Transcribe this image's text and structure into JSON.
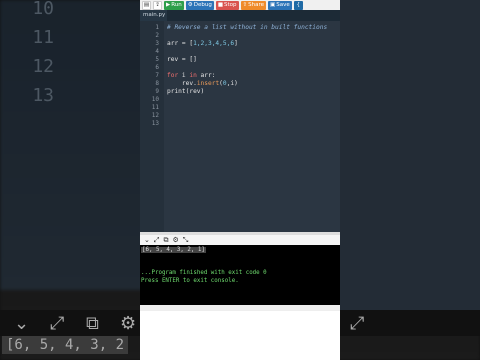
{
  "background": {
    "line_numbers": [
      "10",
      "11",
      "12",
      "13"
    ],
    "output_snippet": "[6, 5, 4, 3, 2"
  },
  "toolbar": {
    "run_label": "Run",
    "debug_label": "Debug",
    "stop_label": "Stop",
    "share_label": "Share",
    "save_label": "Save"
  },
  "tabs": [
    {
      "label": "main.py"
    }
  ],
  "editor": {
    "line_numbers": [
      "1",
      "2",
      "3",
      "4",
      "5",
      "6",
      "7",
      "8",
      "9",
      "10",
      "11",
      "12",
      "13"
    ],
    "lines": {
      "l1": "# Reverse a list without in built functions",
      "l3_a": "arr = [",
      "l3_nums": "1,2,3,4,5,6",
      "l3_b": "]",
      "l5": "rev = []",
      "l7_kw1": "for",
      "l7_mid": " i ",
      "l7_kw2": "in",
      "l7_end": " arr:",
      "l8_a": "    rev.",
      "l8_fn": "insert",
      "l8_b": "(",
      "l8_num": "0",
      "l8_c": ",i)",
      "l9": "print(rev)"
    }
  },
  "console": {
    "output": "[6, 5, 4, 3, 2, 1]",
    "finished": "...Program finished with exit code 0",
    "press_enter": "Press ENTER to exit console."
  },
  "colors": {
    "run": "#2e9e4a",
    "debug": "#2c74b8",
    "stop": "#d9534f",
    "share": "#ef8b2a",
    "console_text": "#6fdc6f"
  }
}
